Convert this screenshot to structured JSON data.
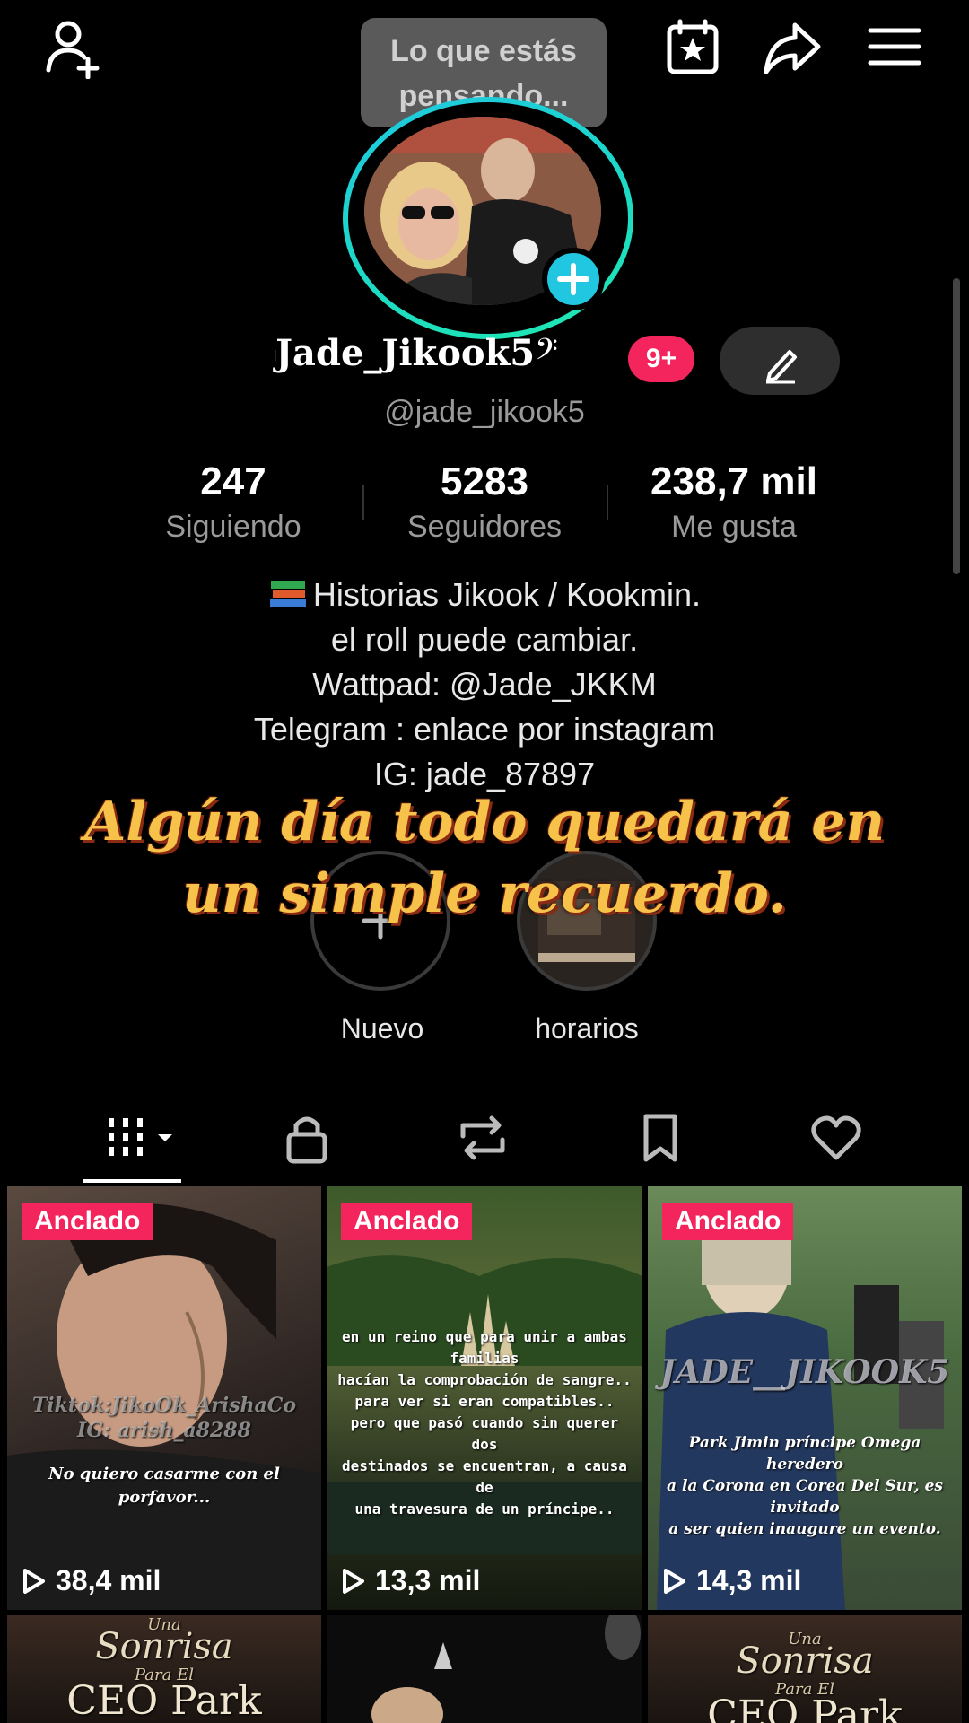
{
  "header": {
    "thought_bubble": "Lo que estás\npensando..."
  },
  "profile": {
    "display_name": "Jade_Jikook5",
    "notification_badge": "9+",
    "handle": "@jade_jikook5"
  },
  "stats": [
    {
      "value": "247",
      "label": "Siguiendo"
    },
    {
      "value": "5283",
      "label": "Seguidores"
    },
    {
      "value": "238,7 mil",
      "label": "Me gusta"
    }
  ],
  "bio": {
    "line1": "Historias Jikook / Kookmin.",
    "line2": "el roll puede cambiar.",
    "line3": "Wattpad: @Jade_JKKM",
    "line4": "Telegram : enlace por instagram",
    "line5": "IG: jade_87897"
  },
  "overlay_caption": "Algún día todo quedará en un simple recuerdo.",
  "highlights": [
    {
      "label": "Nuevo"
    },
    {
      "label": "horarios"
    }
  ],
  "tabs": [
    "videos-grid",
    "private",
    "reposts",
    "favorites",
    "liked"
  ],
  "videos": [
    {
      "badge": "Anclado",
      "views": "38,4 mil",
      "watermark": "Tiktok:JikoOk_ArishaCo\nIG: arish_a8288",
      "caption": "No quiero casarme con el\nporfavor..."
    },
    {
      "badge": "Anclado",
      "views": "13,3 mil",
      "caption": "en un reino que para unir a ambas\nfamilias\nhacían la comprobación de sangre..\npara ver si eran compatibles..\npero que pasó cuando sin querer dos\ndestinados se encuentran, a causa de\nuna travesura de un príncipe.."
    },
    {
      "badge": "Anclado",
      "views": "14,3 mil",
      "watermark": "JADE__JIKOOK5",
      "caption": "Park Jimin príncipe Omega heredero\na la Corona en Corea Del Sur, es invitado\na ser quien inaugure un evento."
    },
    {
      "title_top": "Una",
      "title_mid": "Sonrisa",
      "title_small": "Para El",
      "title_big": "CEO Park"
    },
    {},
    {
      "title_top": "Una",
      "title_mid": "Sonrisa",
      "title_small": "Para El",
      "title_big": "CEO Park"
    }
  ],
  "colors": {
    "accent": "#f4245c",
    "cyan": "#21c6e0",
    "caption_gold": "#f6c24a"
  }
}
